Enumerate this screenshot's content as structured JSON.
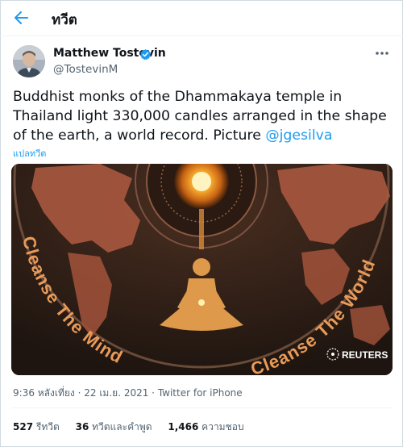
{
  "header": {
    "title": "ทวีต",
    "back_icon": "arrow-left-icon"
  },
  "author": {
    "name": "Matthew Tostevin",
    "handle": "@TostevinM",
    "verified": true,
    "accent": "#1d9bf0"
  },
  "tweet": {
    "text": "Buddhist monks of the Dhammakaya temple in Thailand light 330,000 candles arranged in the shape of the earth, a world record. Picture ",
    "mention": "@jgesilva",
    "translate_label": "แปลทวีต"
  },
  "photo": {
    "caption_left": "Cleanse The Mind",
    "caption_right": "Cleanse The World",
    "watermark": "REUTERS"
  },
  "meta": {
    "time": "9:36 หลังเที่ยง",
    "separator": " · ",
    "date": "22 เม.ย. 2021",
    "source": "Twitter for iPhone"
  },
  "stats": {
    "retweets_count": "527",
    "retweets_label": " รีทวีต",
    "quotes_count": "36",
    "quotes_label": " ทวีตและคำพูด",
    "likes_count": "1,466",
    "likes_label": " ความชอบ"
  }
}
